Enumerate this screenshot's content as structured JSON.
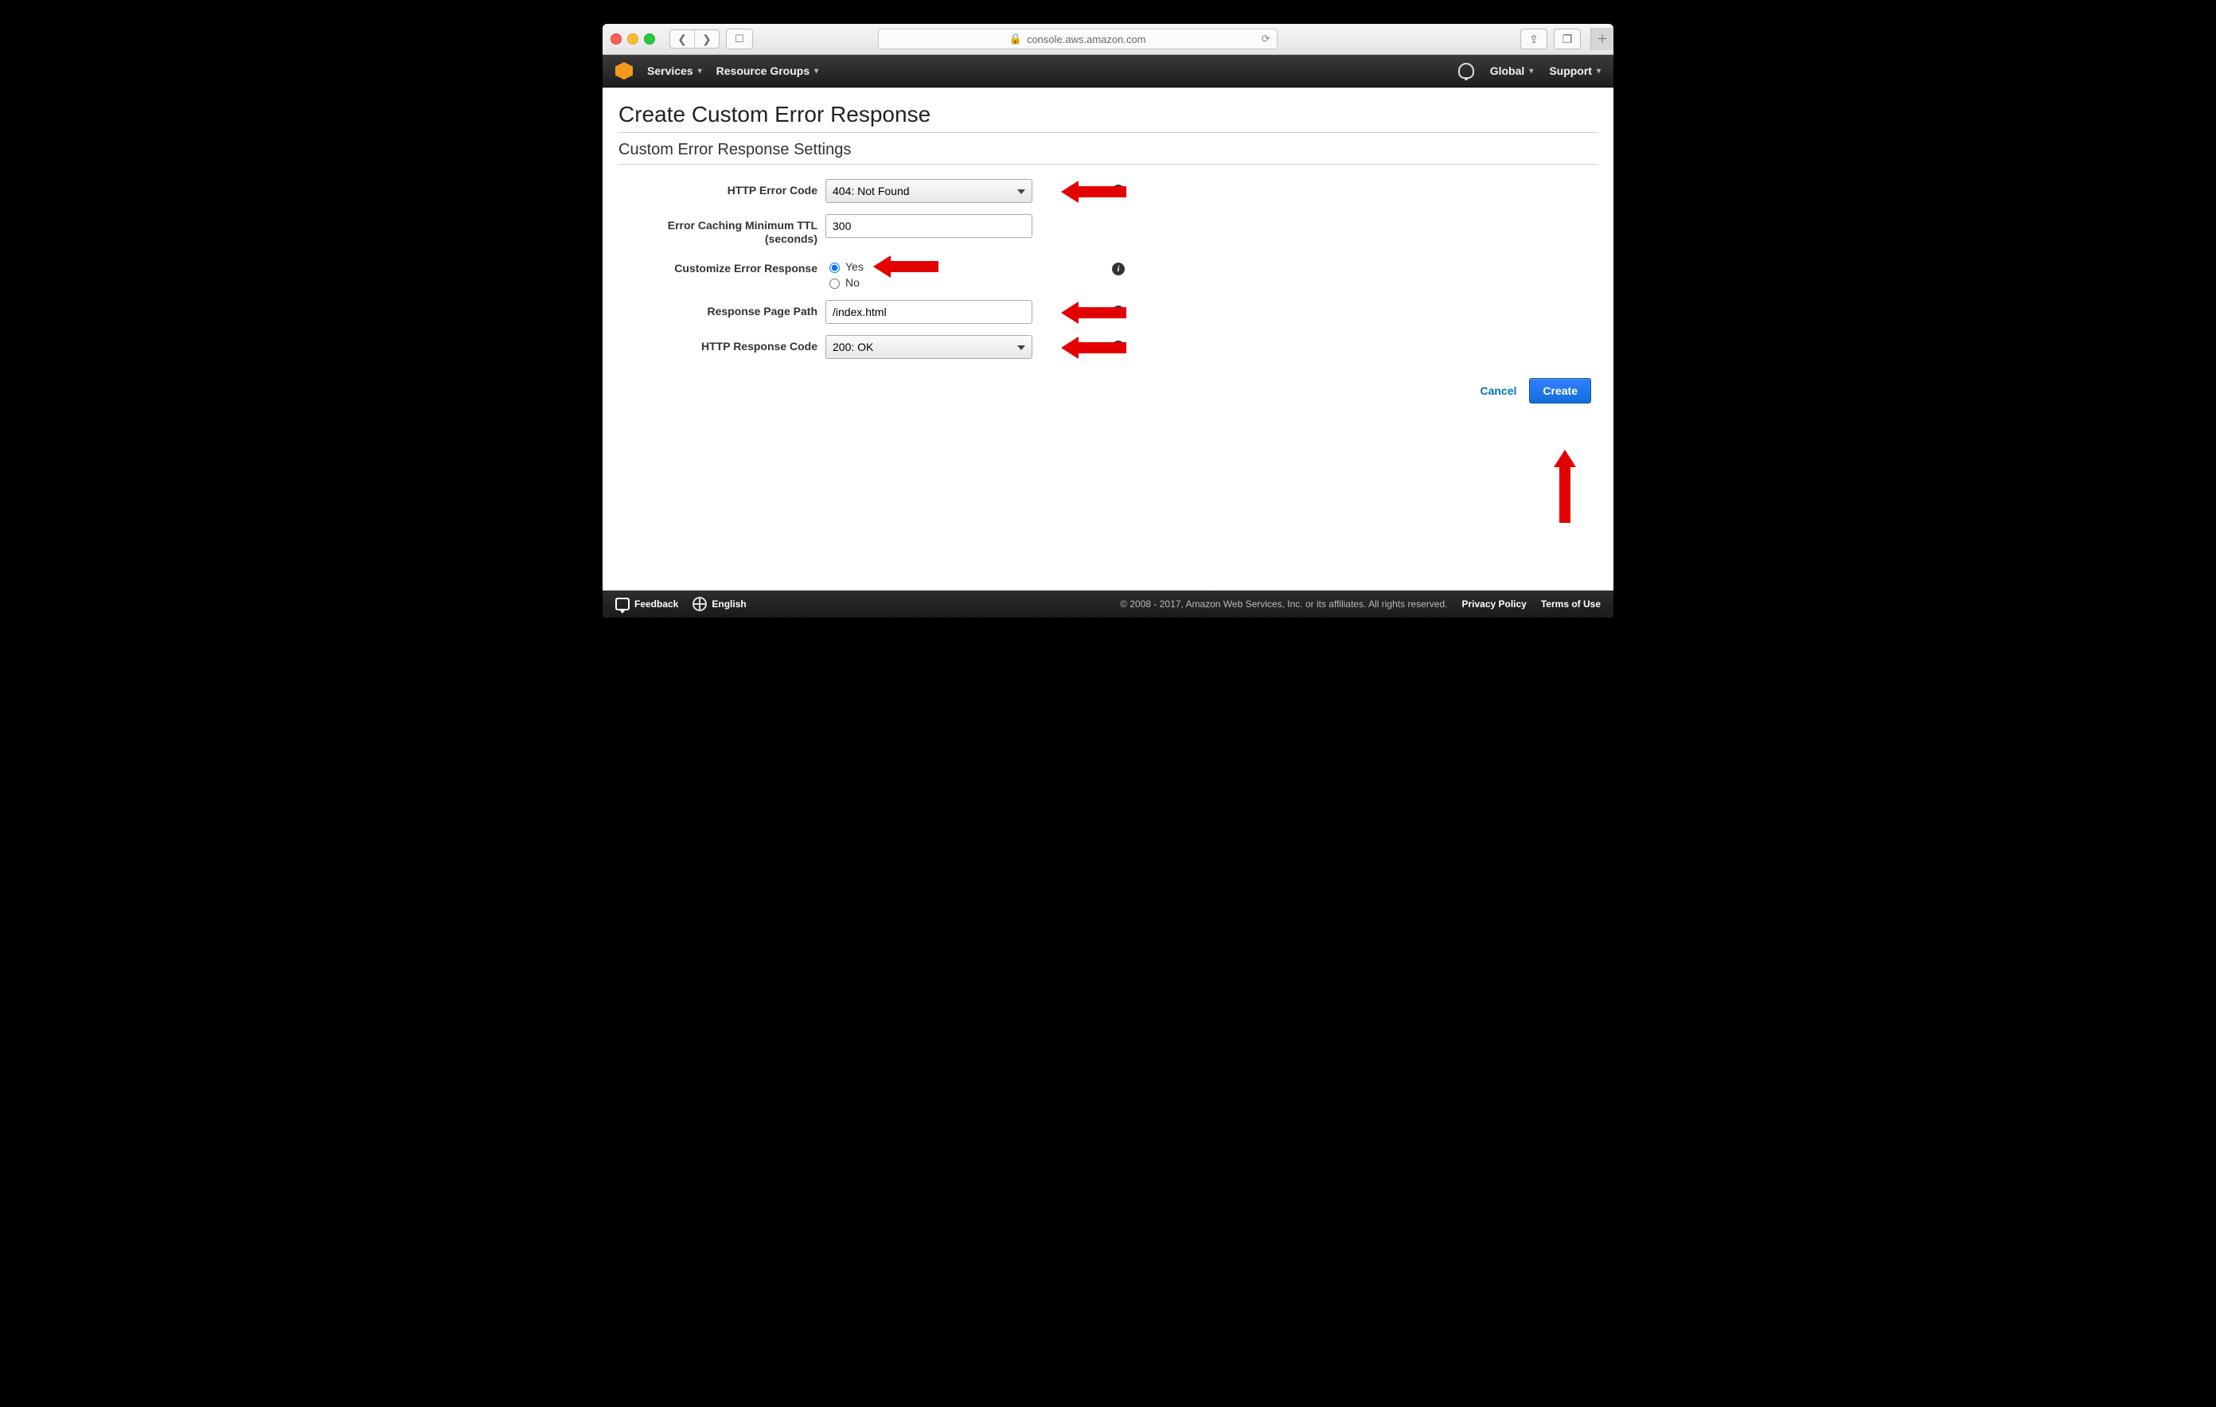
{
  "browser": {
    "address": "console.aws.amazon.com"
  },
  "nav": {
    "services": "Services",
    "resource_groups": "Resource Groups",
    "region": "Global",
    "support": "Support"
  },
  "page": {
    "title": "Create Custom Error Response",
    "section": "Custom Error Response Settings"
  },
  "form": {
    "http_error_code": {
      "label": "HTTP Error Code",
      "value": "404: Not Found"
    },
    "ttl": {
      "label": "Error Caching Minimum TTL (seconds)",
      "value": "300"
    },
    "customize": {
      "label": "Customize Error Response",
      "yes": "Yes",
      "no": "No"
    },
    "page_path": {
      "label": "Response Page Path",
      "value": "/index.html"
    },
    "http_response_code": {
      "label": "HTTP Response Code",
      "value": "200: OK"
    }
  },
  "buttons": {
    "cancel": "Cancel",
    "create": "Create"
  },
  "footer": {
    "feedback": "Feedback",
    "language": "English",
    "copyright": "© 2008 - 2017, Amazon Web Services, Inc. or its affiliates. All rights reserved.",
    "privacy": "Privacy Policy",
    "terms": "Terms of Use"
  }
}
